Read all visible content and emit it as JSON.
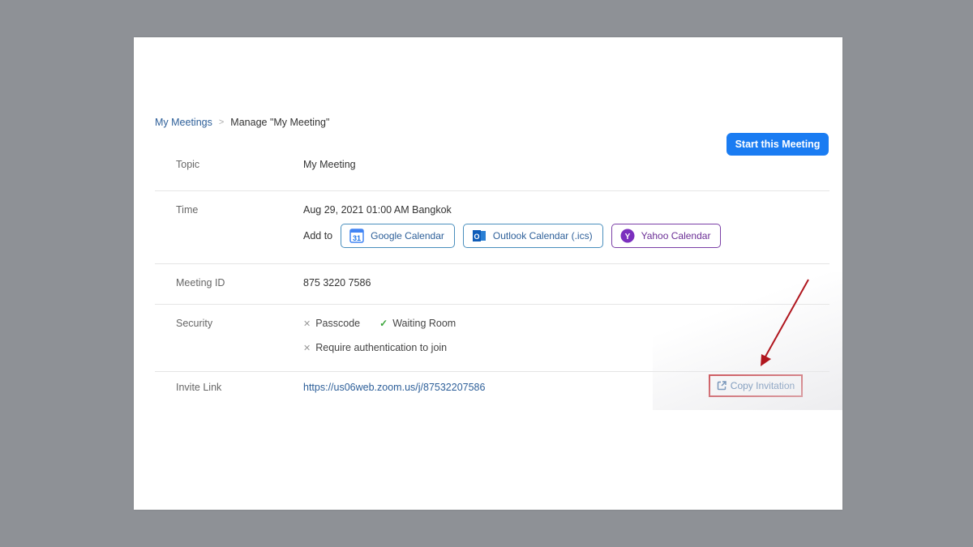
{
  "breadcrumb": {
    "parent": "My Meetings",
    "separator": ">",
    "current": "Manage \"My Meeting\""
  },
  "actions": {
    "start_label": "Start this Meeting",
    "start_color": "#1a7cf2"
  },
  "details": {
    "topic": {
      "label": "Topic",
      "value": "My Meeting"
    },
    "time": {
      "label": "Time",
      "value": "Aug 29, 2021 01:00 AM Bangkok",
      "add_to_label": "Add to",
      "calendars": [
        {
          "label": "Google Calendar",
          "icon": "google-calendar-icon",
          "icon_text": "31"
        },
        {
          "label": "Outlook Calendar (.ics)",
          "icon": "outlook-icon",
          "icon_text": "O"
        },
        {
          "label": "Yahoo Calendar",
          "icon": "yahoo-icon",
          "icon_text": "Y"
        }
      ]
    },
    "meeting_id": {
      "label": "Meeting ID",
      "value": "875 3220 7586"
    },
    "security": {
      "label": "Security",
      "items": [
        {
          "label": "Passcode",
          "enabled": false
        },
        {
          "label": "Waiting Room",
          "enabled": true
        },
        {
          "label": "Require authentication to join",
          "enabled": false
        }
      ]
    },
    "invite": {
      "label": "Invite Link",
      "url": "https://us06web.zoom.us/j/87532207586",
      "copy_label": "Copy Invitation"
    }
  },
  "annotation": {
    "highlight_color": "#c0141c"
  }
}
